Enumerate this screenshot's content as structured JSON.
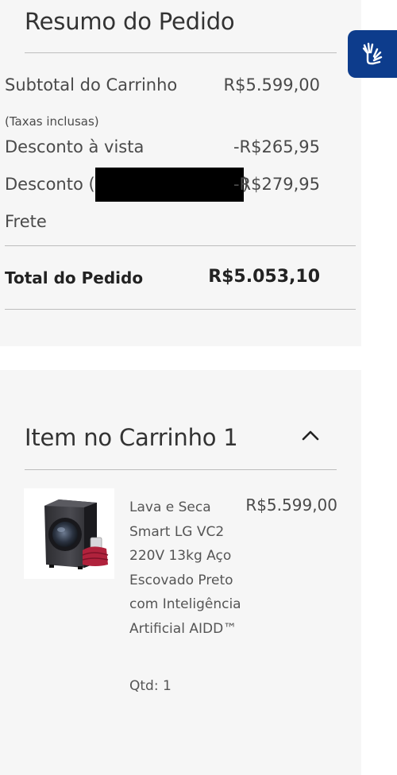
{
  "summary": {
    "title": "Resumo do Pedido",
    "subtotal_label": "Subtotal do Carrinho",
    "subtotal_value": "R$5.599,00",
    "tax_note": "(Taxas inclusas)",
    "cash_discount_label": "Desconto à vista",
    "cash_discount_value": "-R$265,95",
    "coupon_discount_label": "Desconto (",
    "coupon_discount_close": ")",
    "coupon_discount_value": "-R$279,95",
    "shipping_label": "Frete",
    "total_label": "Total do Pedido",
    "total_value": "R$5.053,10"
  },
  "cart": {
    "title": "Item no Carrinho 1",
    "item": {
      "name": "Lava e Seca Smart LG VC2 220V 13kg Aço Escovado Preto com Inteligência Artificial AIDD™",
      "price": "R$5.599,00",
      "qty": "Qtd: 1"
    }
  },
  "icons": {
    "accessibility": "sign-language-hands-icon",
    "collapse": "chevron-up-icon"
  },
  "colors": {
    "panel_bg": "#f6f6f6",
    "accessibility_bg": "#0d3c8c",
    "redaction": "#000000"
  }
}
